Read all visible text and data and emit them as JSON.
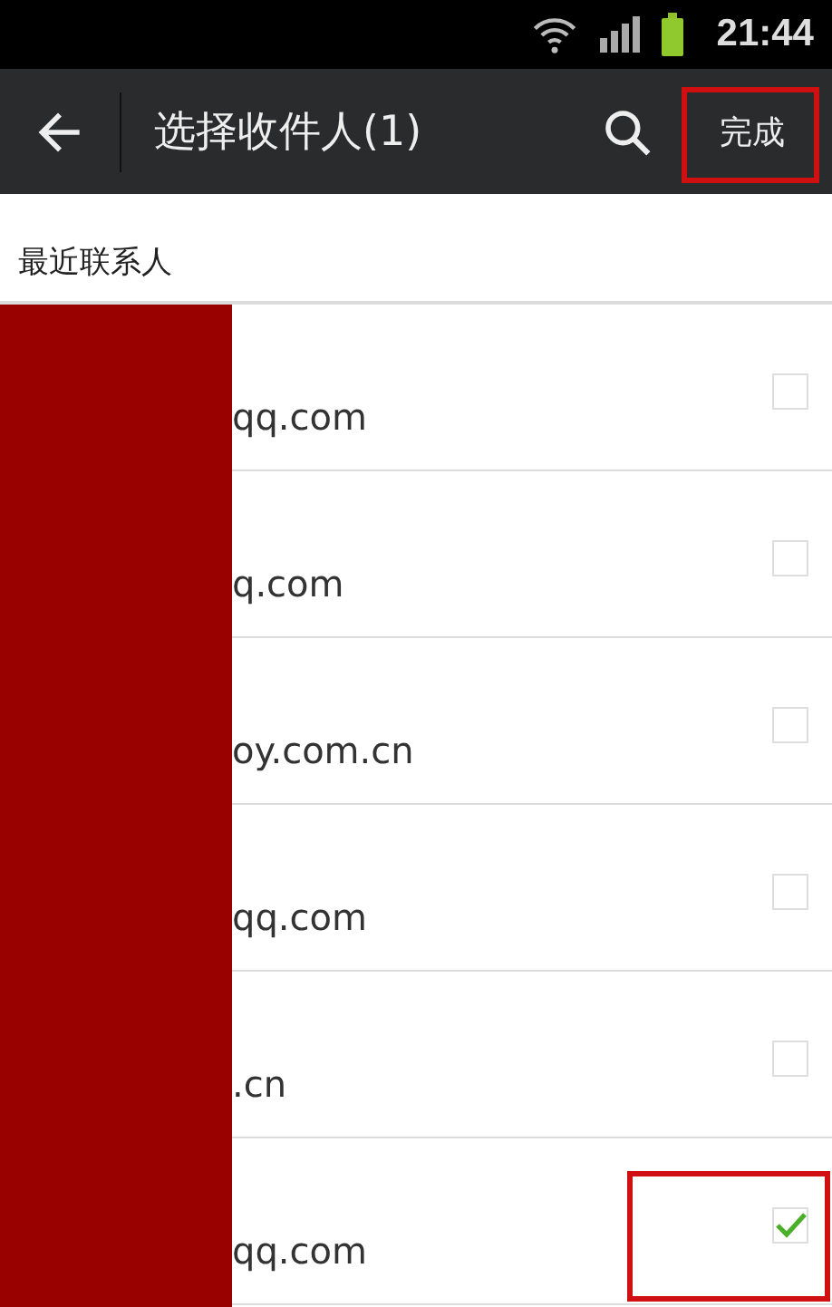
{
  "status_bar": {
    "time": "21:44"
  },
  "app_bar": {
    "title": "选择收件人(1)",
    "action": "完成"
  },
  "section": {
    "title": "最近联系人"
  },
  "contacts": [
    {
      "email": "qq.com",
      "checked": false
    },
    {
      "email": "q.com",
      "checked": false
    },
    {
      "email": "oy.com.cn",
      "checked": false
    },
    {
      "email": "qq.com",
      "checked": false
    },
    {
      "email": ".cn",
      "checked": false
    },
    {
      "email": "qq.com",
      "checked": true
    }
  ]
}
